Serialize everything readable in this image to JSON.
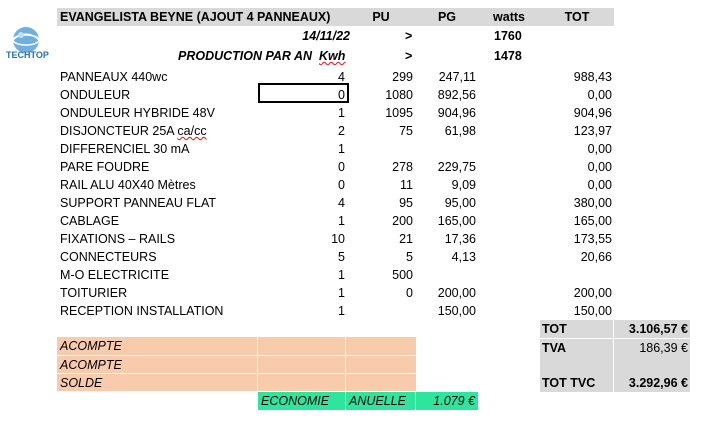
{
  "header": {
    "title": "EVANGELISTA BEYNE (AJOUT 4 PANNEAUX)",
    "pu": "PU",
    "pg": "PG",
    "watts": "watts",
    "tot": "TOT"
  },
  "info": {
    "date": "14/11/22",
    "date_arrow": ">",
    "date_value": "1760",
    "production_label": "PRODUCTION PAR AN",
    "production_unit": "Kwh",
    "production_arrow": ">",
    "production_value": "1478"
  },
  "logo": {
    "text": "TECHTOP"
  },
  "items": [
    {
      "label": "PANNEAUX 440wc",
      "qty": "4",
      "pu": "299",
      "pg": "247,11",
      "tot": "988,43"
    },
    {
      "label": "ONDULEUR",
      "qty": "0",
      "pu": "1080",
      "pg": "892,56",
      "tot": "0,00"
    },
    {
      "label": "ONDULEUR HYBRIDE 48V",
      "qty": "1",
      "pu": "1095",
      "pg": "904,96",
      "tot": "904,96"
    },
    {
      "label": "DISJONCTEUR 25A ca/cc",
      "qty": "2",
      "pu": "75",
      "pg": "61,98",
      "tot": "123,97"
    },
    {
      "label": "DIFFERENCIEL 30 mA",
      "qty": "1",
      "pu": "",
      "pg": "",
      "tot": "0,00"
    },
    {
      "label": "PARE FOUDRE",
      "qty": "0",
      "pu": "278",
      "pg": "229,75",
      "tot": "0,00"
    },
    {
      "label": "RAIL ALU 40X40   Mètres",
      "qty": "0",
      "pu": "11",
      "pg": "9,09",
      "tot": "0,00"
    },
    {
      "label": "SUPPORT PANNEAU FLAT",
      "qty": "4",
      "pu": "95",
      "pg": "95,00",
      "tot": "380,00"
    },
    {
      "label": "CABLAGE",
      "qty": "1",
      "pu": "200",
      "pg": "165,00",
      "tot": "165,00"
    },
    {
      "label": "FIXATIONS – RAILS",
      "qty": "10",
      "pu": "21",
      "pg": "17,36",
      "tot": "173,55"
    },
    {
      "label": "CONNECTEURS",
      "qty": "5",
      "pu": "5",
      "pg": "4,13",
      "tot": "20,66"
    },
    {
      "label": "M-O ELECTRICITE",
      "qty": "1",
      "pu": "500",
      "pg": "",
      "tot": ""
    },
    {
      "label": "TOITURIER",
      "qty": "1",
      "pu": "0",
      "pg": "200,00",
      "tot": "200,00"
    },
    {
      "label": "RECEPTION INSTALLATION",
      "qty": "1",
      "pu": "",
      "pg": "150,00",
      "tot": "150,00"
    }
  ],
  "payments": [
    {
      "label": "ACOMPTE"
    },
    {
      "label": "ACOMPTE"
    },
    {
      "label": "SOLDE"
    }
  ],
  "economie": {
    "label1": "ECONOMIE",
    "label2": "ANUELLE",
    "value": "1.079 €"
  },
  "totals": {
    "tot_label": "TOT",
    "tot_value": "3.106,57 €",
    "tva_label": "TVA",
    "tva_value": "186,39 €",
    "ttc_label": "TOT TVC",
    "ttc_value": "3.292,96 €"
  },
  "colors": {
    "header_grey": "#d9d9d9",
    "payment_peach": "#f8cbad",
    "economie_green": "#2ee59d"
  }
}
